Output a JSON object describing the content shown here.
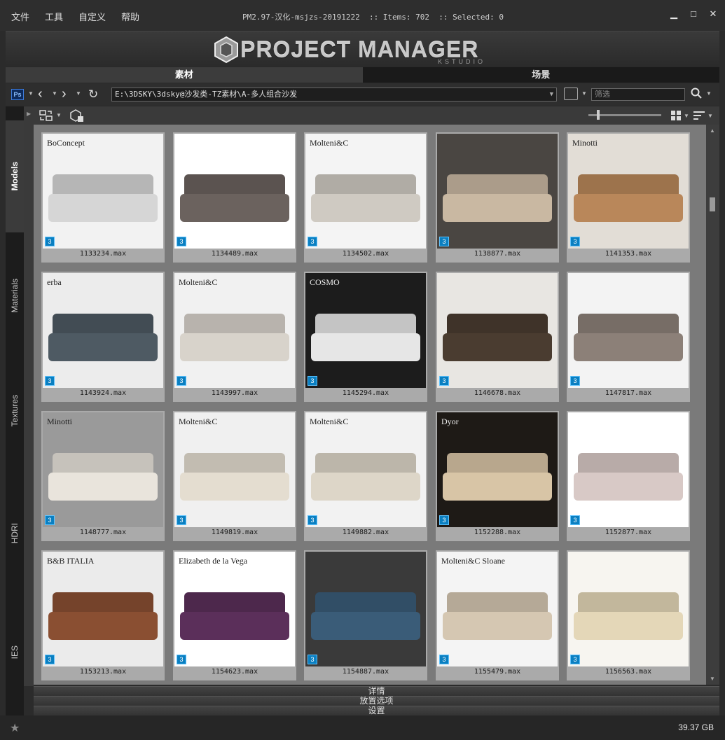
{
  "menu": [
    "文件",
    "工具",
    "自定义",
    "帮助"
  ],
  "window_title": "PM2.97-汉化-msjzs-20191222  :: Items: 702  :: Selected: 0",
  "window_controls": [
    "minimize-icon",
    "maximize-icon",
    "close-icon"
  ],
  "logo": {
    "text": "PROJECT MANAGER",
    "sub": "KSTUDIO"
  },
  "main_tabs": [
    {
      "label": "素材",
      "active": true
    },
    {
      "label": "场景",
      "active": false
    }
  ],
  "toolbar": {
    "path": "E:\\3DSKY\\3dsky@沙发类-TZ素材\\A-多人组合沙发",
    "filter_placeholder": "筛选",
    "ps_label": "Ps"
  },
  "side_tabs": [
    {
      "label": "Models",
      "active": true
    },
    {
      "label": "Materials",
      "active": false
    },
    {
      "label": "Textures",
      "active": false
    },
    {
      "label": "HDRI",
      "active": false
    },
    {
      "label": "IES",
      "active": false
    }
  ],
  "items": [
    {
      "name": "1133234.max",
      "brand": "BoConcept",
      "bg": "#f2f2f2",
      "sofa": "#d6d6d6"
    },
    {
      "name": "1134489.max",
      "brand": "",
      "bg": "#ffffff",
      "sofa": "#6b625e"
    },
    {
      "name": "1134502.max",
      "brand": "Molteni&C",
      "bg": "#f4f4f4",
      "sofa": "#cfcac2"
    },
    {
      "name": "1138877.max",
      "brand": "",
      "bg": "#4a4642",
      "sofa": "#c9b8a2"
    },
    {
      "name": "1141353.max",
      "brand": "Minotti",
      "bg": "#e2ddd6",
      "sofa": "#b9875a"
    },
    {
      "name": "1143924.max",
      "brand": "erba",
      "bg": "#ececec",
      "sofa": "#4e5a63"
    },
    {
      "name": "1143997.max",
      "brand": "Molteni&C",
      "bg": "#f1f1f1",
      "sofa": "#d8d3cb"
    },
    {
      "name": "1145294.max",
      "brand": "COSMO",
      "bg": "#1c1c1c",
      "sofa": "#e6e6e6"
    },
    {
      "name": "1146678.max",
      "brand": "",
      "bg": "#e8e6e2",
      "sofa": "#4a3c30"
    },
    {
      "name": "1147817.max",
      "brand": "",
      "bg": "#f3f3f3",
      "sofa": "#8c8078"
    },
    {
      "name": "1148777.max",
      "brand": "Minotti",
      "bg": "#9a9a9a",
      "sofa": "#e9e4dc"
    },
    {
      "name": "1149819.max",
      "brand": "Molteni&C",
      "bg": "#f0f0f0",
      "sofa": "#e4ddd0"
    },
    {
      "name": "1149882.max",
      "brand": "Molteni&C",
      "bg": "#f2f2f2",
      "sofa": "#ddd6c8"
    },
    {
      "name": "1152288.max",
      "brand": "Dyor",
      "bg": "#1e1a16",
      "sofa": "#d8c5a6"
    },
    {
      "name": "1152877.max",
      "brand": "",
      "bg": "#ffffff",
      "sofa": "#d8c9c6"
    },
    {
      "name": "1153213.max",
      "brand": "B&B ITALIA",
      "bg": "#ebebeb",
      "sofa": "#8a4f32"
    },
    {
      "name": "1154623.max",
      "brand": "Elizabeth de la Vega",
      "bg": "#ffffff",
      "sofa": "#5b2f5a"
    },
    {
      "name": "1154887.max",
      "brand": "",
      "bg": "#3a3a3a",
      "sofa": "#3a5c78"
    },
    {
      "name": "1155479.max",
      "brand": "Molteni&C Sloane",
      "bg": "#f4f4f4",
      "sofa": "#d5c7b2"
    },
    {
      "name": "1156563.max",
      "brand": "",
      "bg": "#f7f5f0",
      "sofa": "#e4d7b8"
    }
  ],
  "panels": [
    "详情",
    "放置选项",
    "设置"
  ],
  "status": {
    "disk": "39.37 GB"
  }
}
